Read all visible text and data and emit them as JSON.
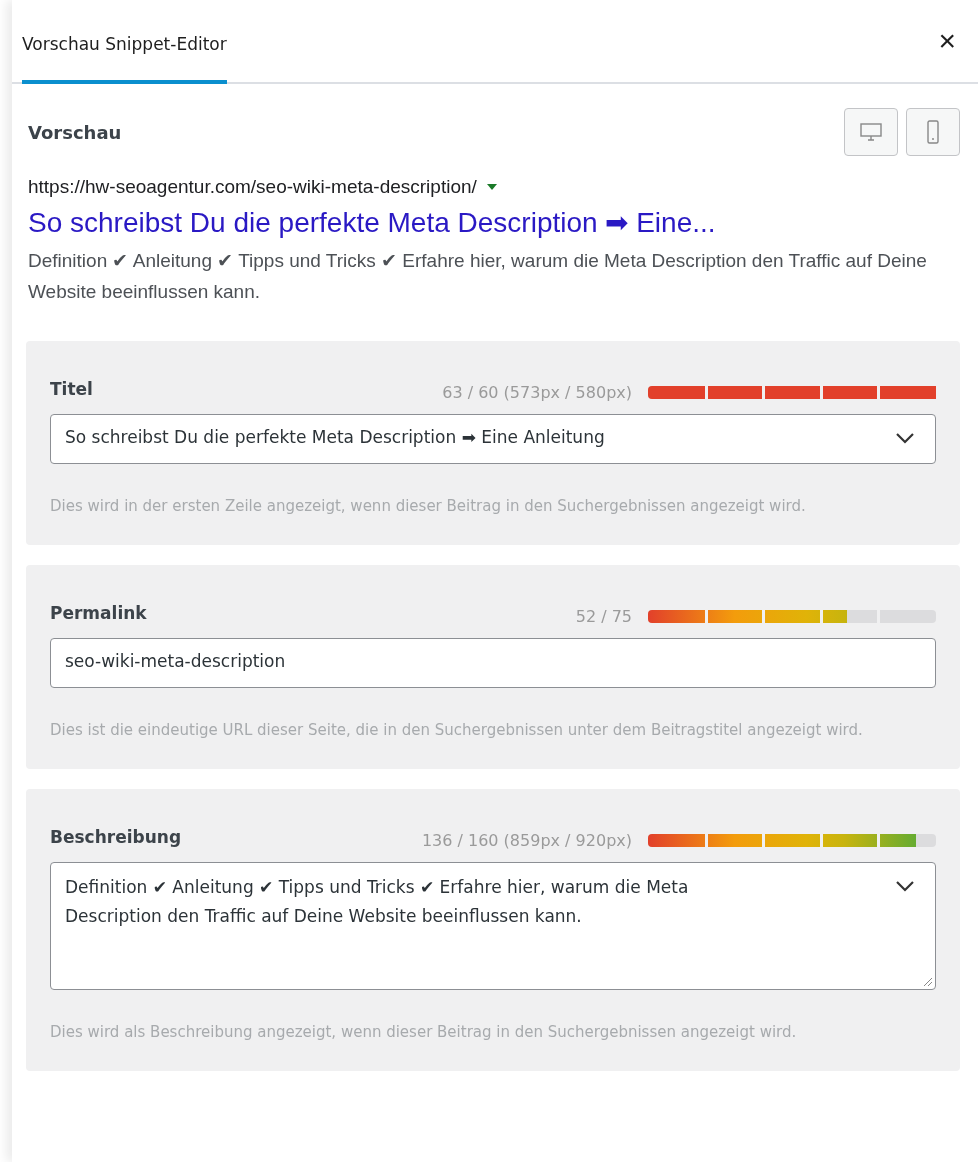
{
  "header": {
    "tabs": [
      {
        "label": "Vorschau Snippet-Editor",
        "selected": true
      }
    ],
    "close": "×"
  },
  "preview": {
    "heading": "Vorschau",
    "devices": [
      {
        "kind": "desktop",
        "selected": false
      },
      {
        "kind": "mobile",
        "selected": false
      }
    ],
    "url": "https://hw-seoagentur.com/seo-wiki-meta-description/",
    "title": "So schreibst Du die perfekte Meta Description ➡ Eine...",
    "description": "Definition ✔ Anleitung ✔ Tipps und Tricks ✔ Erfahre hier, warum die Meta Description den Traffic auf Deine Website beeinflussen kann."
  },
  "fields": [
    {
      "kind": "input",
      "label": "Titel",
      "count": "63 / 60 (573px / 580px)",
      "level": 1,
      "over": true,
      "value": "So schreibst Du die perfekte Meta Description ➡ Eine Anleitung",
      "has_menu": true,
      "help": "Dies wird in der ersten Zeile angezeigt, wenn dieser Beitrag in den Suchergebnissen angezeigt wird."
    },
    {
      "kind": "input",
      "label": "Permalink",
      "count": "52 / 75",
      "level": 0.69,
      "over": false,
      "value": "seo-wiki-meta-description",
      "has_menu": false,
      "help": "Dies ist die eindeutige URL dieser Seite, die in den Suchergebnissen unter dem Beitragstitel angezeigt wird."
    },
    {
      "kind": "textarea",
      "label": "Beschreibung",
      "count": "136 / 160 (859px / 920px)",
      "level": 0.93,
      "over": false,
      "value": "Definition ✔ Anleitung ✔ Tipps und Tricks ✔ Erfahre hier, warum die Meta Description den Traffic auf Deine Website beeinflussen kann.",
      "has_menu": true,
      "help": "Dies wird als Beschreibung angezeigt, wenn dieser Beitrag in den Suchergebnissen angezeigt wird."
    }
  ]
}
